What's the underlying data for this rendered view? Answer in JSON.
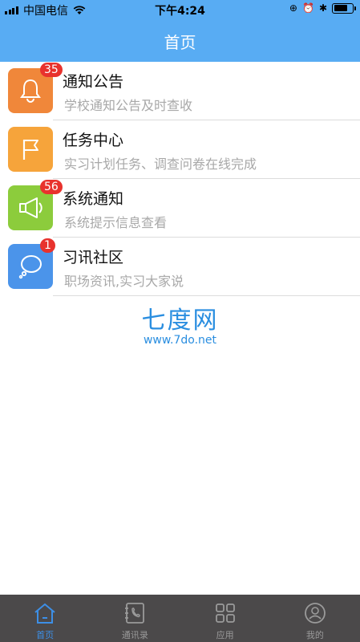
{
  "status_bar": {
    "carrier": "中国电信",
    "time": "下午4:24"
  },
  "header": {
    "title": "首页"
  },
  "colors": {
    "header_bg": "#58acf3",
    "notice": "#f0873a",
    "task": "#f6a43b",
    "system": "#8ccc3c",
    "community": "#4b94ea",
    "badge": "#e8322d",
    "tab_active": "#3d8fe6"
  },
  "items": [
    {
      "title": "通知公告",
      "subtitle": "学校通知公告及时查收",
      "badge": "35",
      "icon": "bell-icon"
    },
    {
      "title": "任务中心",
      "subtitle": "实习计划任务、调查问卷在线完成",
      "badge": "",
      "icon": "flag-icon"
    },
    {
      "title": "系统通知",
      "subtitle": "系统提示信息查看",
      "badge": "56",
      "icon": "megaphone-icon"
    },
    {
      "title": "习讯社区",
      "subtitle": "职场资讯,实习大家说",
      "badge": "1",
      "icon": "thought-bubble-icon"
    }
  ],
  "watermark": {
    "brand": "七度网",
    "url": "www.7do.net"
  },
  "tabs": [
    {
      "label": "首页",
      "icon": "home-icon",
      "active": true
    },
    {
      "label": "通讯录",
      "icon": "contacts-icon",
      "active": false
    },
    {
      "label": "应用",
      "icon": "apps-grid-icon",
      "active": false
    },
    {
      "label": "我的",
      "icon": "profile-icon",
      "active": false
    }
  ]
}
